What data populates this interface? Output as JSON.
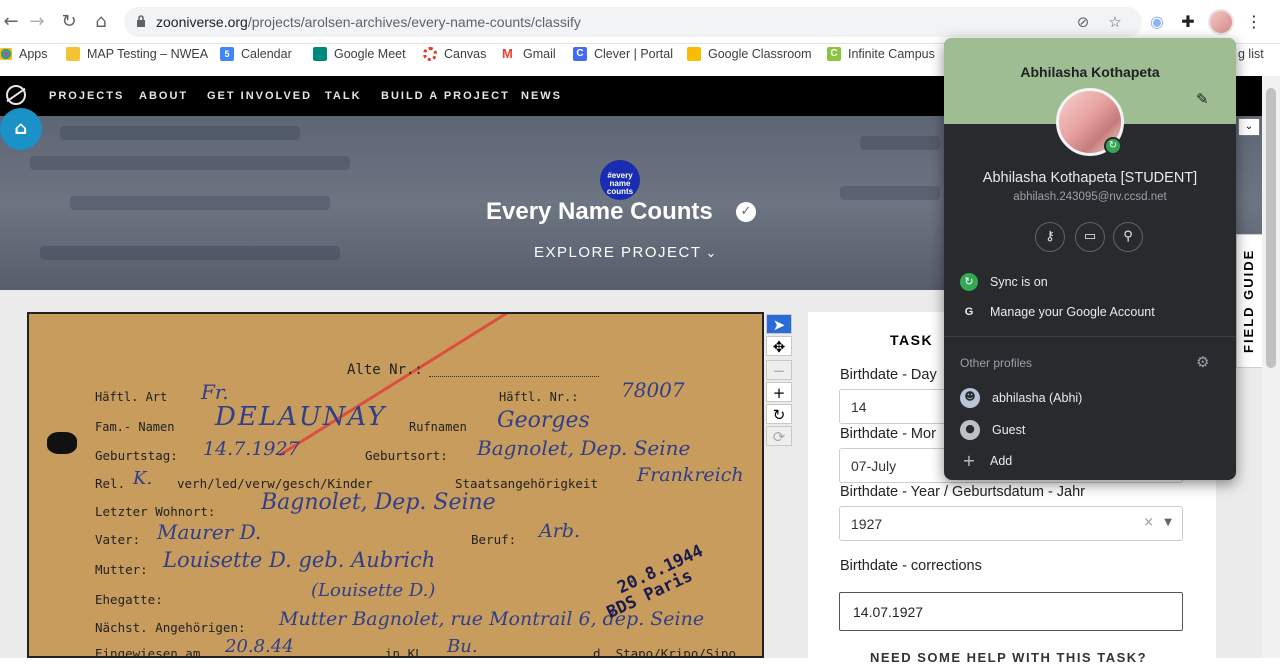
{
  "browser": {
    "url_host": "zooniverse.org",
    "url_path": "/projects/arolsen-archives/every-name-counts/classify",
    "bookmarks": [
      "Apps",
      "MAP Testing – NWEA",
      "Calendar",
      "Google Meet",
      "Canvas",
      "Gmail",
      "Clever | Portal",
      "Google Classroom",
      "Infinite Campus"
    ],
    "bookmark_overflow": "g list",
    "calendar_icon_text": "5"
  },
  "sitenav": {
    "links": [
      "PROJECTS",
      "ABOUT",
      "GET INVOLVED",
      "TALK",
      "BUILD A PROJECT",
      "NEWS"
    ]
  },
  "hero": {
    "badge_text": "#every name counts",
    "title": "Every Name Counts",
    "explore": "EXPLORE PROJECT"
  },
  "document": {
    "labels": {
      "alte_nr": "Alte Nr.:",
      "haftl_art": "Häftl. Art",
      "haftl_nr": "Häftl. Nr.:",
      "fam_name": "Fam.- Namen",
      "rufnamen": "Rufnamen",
      "geburtstag": "Geburtstag:",
      "geburtsort": "Geburtsort:",
      "rel": "Rel.",
      "verh": "verh/led/verw/gesch/Kinder",
      "staat": "Staatsangehörigkeit",
      "wohnort": "Letzter Wohnort:",
      "vater": "Vater:",
      "beruf": "Beruf:",
      "mutter": "Mutter:",
      "ehegatte": "Ehegatte:",
      "nachst": "Nächst. Angehörigen:",
      "eingewiesen": "Eingewiesen am",
      "in_kl": "in KL",
      "stapo": "d. Stapo/Kripo/Sipo"
    },
    "hand": {
      "art": "Fr.",
      "nr": "78007",
      "name": "DELAUNAY",
      "rufname": "Georges",
      "geburtstag": "14.7.1927",
      "geburtsort": "Bagnolet, Dep. Seine",
      "rel": "K.",
      "staat": "Frankreich",
      "wohnort": "Bagnolet, Dep. Seine",
      "vater": "Maurer D.",
      "beruf": "Arb.",
      "mutter": "Louisette D. geb. Aubrich",
      "ehegatte": "(Louisette D.)",
      "nachst": "Mutter Bagnolet, rue Montrail 6, dep. Seine",
      "eingewiesen": "20.8.44",
      "kl": "Bu."
    },
    "stamp_line1": "20.8.1944",
    "stamp_line2": "BDS Paris"
  },
  "task": {
    "tab_label": "TASK",
    "fields": [
      {
        "label": "Birthdate - Day",
        "value": "14"
      },
      {
        "label": "Birthdate - Mor",
        "value": "07-July"
      },
      {
        "label": "Birthdate - Year / Geburtsdatum - Jahr",
        "value": "1927"
      }
    ],
    "corrections_label": "Birthdate - corrections",
    "corrections_value": "14.07.1927",
    "help_partial": "NEED SOME HELP WITH THIS TASK?",
    "field_guide": "FIELD GUIDE"
  },
  "profile": {
    "header_name": "Abhilasha Kothapeta",
    "full_name": "Abhilasha Kothapeta [STUDENT]",
    "email": "abhilash.243095@nv.ccsd.net",
    "sync": "Sync is on",
    "manage": "Manage your Google Account",
    "other_profiles_label": "Other profiles",
    "others": [
      "abhilasha (Abhi)",
      "Guest",
      "Add"
    ]
  },
  "colors": {
    "profile_header": "#9fbd93",
    "profile_bg": "#292a2d",
    "nav_bg": "#000000",
    "classroom_btn": "#1a91c7"
  }
}
